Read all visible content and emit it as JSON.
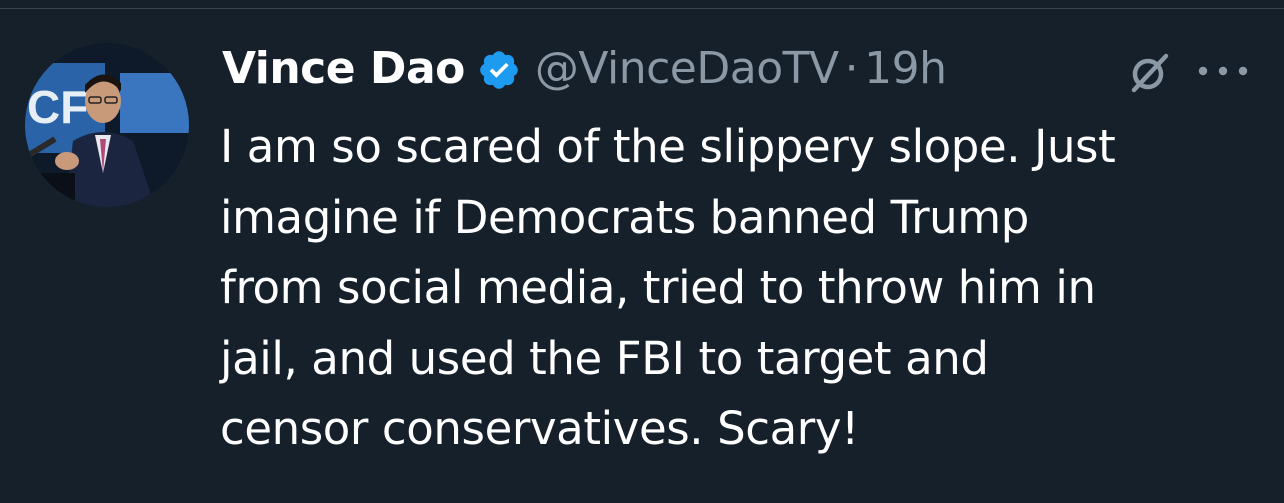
{
  "tweet": {
    "author": {
      "display_name": "Vince Dao",
      "handle": "@VinceDaoTV",
      "verified": true
    },
    "separator": "·",
    "time_ago": "19h",
    "text_lines": [
      "I am so scared of the slippery slope. Just",
      "imagine if Democrats banned Trump",
      "from social media, tried to throw him in",
      "jail, and used the FBI to target and",
      "censor conservatives. Scary!"
    ]
  },
  "colors": {
    "background": "#15202b",
    "text_primary": "#ffffff",
    "text_secondary": "#8b98a5",
    "verified_badge": "#1d9bf0",
    "divider": "#38444d"
  },
  "icons": {
    "verified": "verified-badge-icon",
    "grok": "grok-icon",
    "more": "more-options-icon"
  }
}
